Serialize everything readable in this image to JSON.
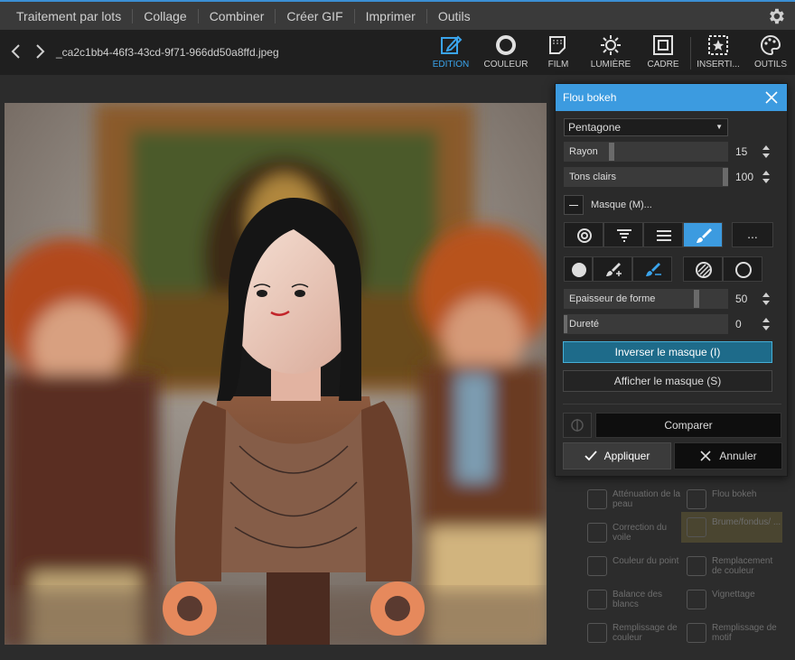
{
  "topbar": {
    "items": [
      "Traitement par lots",
      "Collage",
      "Combiner",
      "Créer GIF",
      "Imprimer",
      "Outils"
    ],
    "settings_icon": "gear-icon"
  },
  "toolbar": {
    "filename": "_ca2c1bb4-46f3-43cd-9f71-966dd50a8ffd.jpeg",
    "tools": [
      "EDITION",
      "COULEUR",
      "FILM",
      "LUMIÈRE",
      "CADRE",
      "INSERTI...",
      "OUTILS"
    ],
    "active_tool": "EDITION",
    "accent": "#3aa4ec"
  },
  "panel": {
    "title": "Flou bokeh",
    "shape": "Pentagone",
    "rayon": {
      "label": "Rayon",
      "value": "15",
      "fraction": 0.15
    },
    "tons": {
      "label": "Tons clairs",
      "value": "100",
      "fraction": 1.0
    },
    "mask_label": "Masque (M)...",
    "more_label": "...",
    "epaisseur": {
      "label": "Epaisseur de forme",
      "value": "50",
      "fraction": 0.5
    },
    "durete": {
      "label": "Dureté",
      "value": "0",
      "fraction": 0.0
    },
    "invert_label": "Inverser le masque (I)",
    "show_label": "Afficher le masque (S)",
    "compare_label": "Comparer",
    "apply_label": "Appliquer",
    "cancel_label": "Annuler",
    "header_color": "#3c9be0"
  },
  "side_list": [
    "Atténuation de la peau",
    "Flou bokeh",
    "Correction du voile",
    "Brume/fondus/ ...",
    "Couleur du point",
    "Remplacement de couleur",
    "Balance des blancs",
    "Vignettage",
    "Remplissage de couleur",
    "Remplissage de motif"
  ]
}
